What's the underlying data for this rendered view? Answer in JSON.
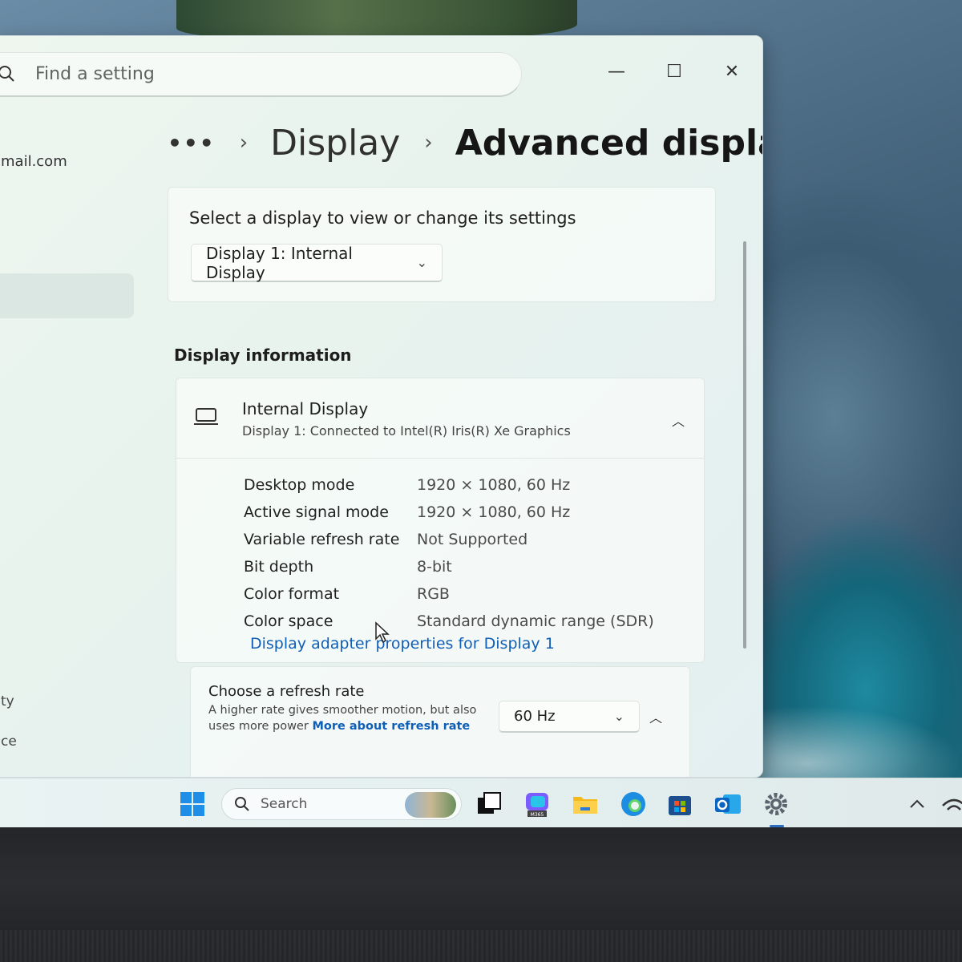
{
  "window": {
    "search_placeholder": "Find a setting",
    "controls": {
      "minimize": "—",
      "maximize": "☐",
      "close": "✕"
    }
  },
  "sidebar": {
    "account_email_fragment": "mail.com",
    "frag1": "ty",
    "frag2": "ce"
  },
  "breadcrumb": {
    "more": "•••",
    "separator": "›",
    "parent": "Display",
    "current": "Advanced display"
  },
  "select_display": {
    "prompt": "Select a display to view or change its settings",
    "selected": "Display 1: Internal Display"
  },
  "display_info": {
    "section_title": "Display information",
    "device_name": "Internal Display",
    "device_subtitle": "Display 1: Connected to Intel(R) Iris(R) Xe Graphics",
    "rows": [
      {
        "label": "Desktop mode",
        "value": "1920 × 1080, 60 Hz"
      },
      {
        "label": "Active signal mode",
        "value": "1920 × 1080, 60 Hz"
      },
      {
        "label": "Variable refresh rate",
        "value": "Not Supported"
      },
      {
        "label": "Bit depth",
        "value": "8-bit"
      },
      {
        "label": "Color format",
        "value": "RGB"
      },
      {
        "label": "Color space",
        "value": "Standard dynamic range (SDR)"
      }
    ],
    "adapter_link": "Display adapter properties for Display 1"
  },
  "refresh_rate": {
    "title": "Choose a refresh rate",
    "description": "A higher rate gives smoother motion, but also uses more power",
    "link": "More about refresh rate",
    "selected": "60 Hz"
  },
  "taskbar": {
    "search_label": "Search",
    "m365_badge": "M365"
  },
  "colors": {
    "accent": "#0f5fb8",
    "windows_blue": "#1e8ee6"
  }
}
